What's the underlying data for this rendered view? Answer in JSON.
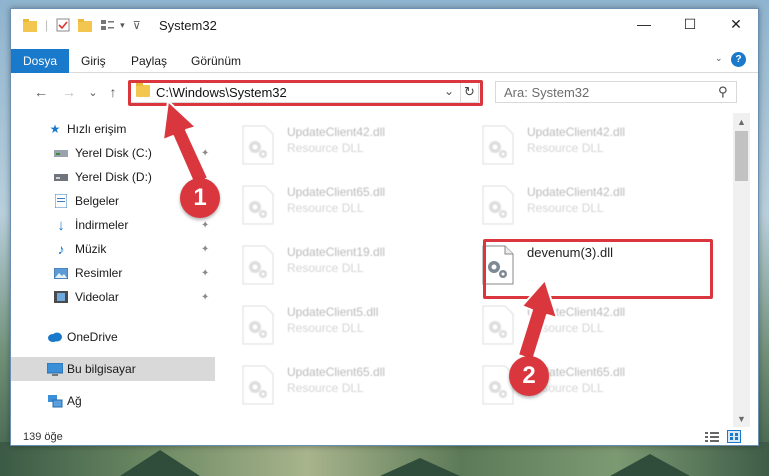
{
  "window": {
    "title": "System32",
    "controls": {
      "minimize": "—",
      "maximize": "☐",
      "close": "✕"
    }
  },
  "ribbon": {
    "tabs": [
      "Dosya",
      "Giriş",
      "Paylaş",
      "Görünüm"
    ],
    "active_tab": "Dosya",
    "help_icon": "?"
  },
  "navigation": {
    "back": "←",
    "forward": "→",
    "recent": "⌄",
    "up": "↑",
    "address": "C:\\Windows\\System32",
    "address_dropdown": "⌄",
    "refresh": "↻",
    "search_placeholder": "Ara: System32",
    "search_icon": "⚲"
  },
  "sidebar": {
    "items": [
      {
        "label": "Hızlı erişim",
        "icon": "star-icon",
        "pinned": false
      },
      {
        "label": "Yerel Disk (C:)",
        "icon": "drive-icon",
        "pinned": true
      },
      {
        "label": "Yerel Disk (D:)",
        "icon": "drive-icon",
        "pinned": true
      },
      {
        "label": "Belgeler",
        "icon": "documents-icon",
        "pinned": true
      },
      {
        "label": "İndirmeler",
        "icon": "download-icon",
        "pinned": true
      },
      {
        "label": "Müzik",
        "icon": "music-icon",
        "pinned": true
      },
      {
        "label": "Resimler",
        "icon": "pictures-icon",
        "pinned": true
      },
      {
        "label": "Videolar",
        "icon": "videos-icon",
        "pinned": true
      },
      {
        "label": "OneDrive",
        "icon": "cloud-icon",
        "pinned": false
      },
      {
        "label": "Bu bilgisayar",
        "icon": "computer-icon",
        "pinned": false,
        "selected": true
      },
      {
        "label": "Ağ",
        "icon": "network-icon",
        "pinned": false
      }
    ],
    "pin_glyph": "📌"
  },
  "files": [
    {
      "name": "UpdateClient42.dll",
      "type": "Resource DLL",
      "dim": true
    },
    {
      "name": "UpdateClient42.dll",
      "type": "Resource DLL",
      "dim": true
    },
    {
      "name": "UpdateClient65.dll",
      "type": "Resource DLL",
      "dim": true
    },
    {
      "name": "UpdateClient42.dll",
      "type": "Resource DLL",
      "dim": true
    },
    {
      "name": "UpdateClient19.dll",
      "type": "Resource DLL",
      "dim": true
    },
    {
      "name": "devenum(3).dll",
      "type": "",
      "dim": false,
      "highlighted": true
    },
    {
      "name": "UpdateClient5.dll",
      "type": "Resource DLL",
      "dim": true
    },
    {
      "name": "UpdateClient42.dll",
      "type": "Resource DLL",
      "dim": true
    },
    {
      "name": "UpdateClient65.dll",
      "type": "Resource DLL",
      "dim": true
    },
    {
      "name": "UpdateClient65.dll",
      "type": "Resource DLL",
      "dim": true
    }
  ],
  "status": {
    "item_count": "139 öğe"
  },
  "annotations": {
    "step1": "1",
    "step2": "2"
  },
  "colors": {
    "accent": "#1979ca",
    "annotation": "#d9363e"
  }
}
